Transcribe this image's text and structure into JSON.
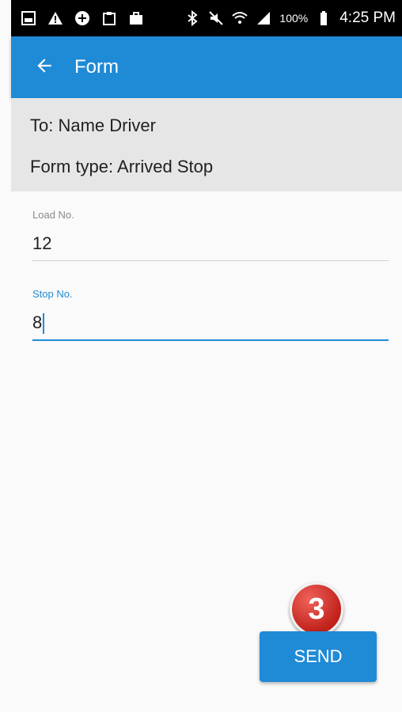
{
  "status_bar": {
    "battery": "100%",
    "time": "4:25 PM"
  },
  "app_bar": {
    "title": "Form"
  },
  "header": {
    "to_label": "To:",
    "to_value": "Name Driver",
    "form_type_label": "Form type:",
    "form_type_value": "Arrived Stop"
  },
  "form": {
    "load_no": {
      "label": "Load No.",
      "value": "12"
    },
    "stop_no": {
      "label": "Stop No.",
      "value": "8"
    }
  },
  "step_badge": "3",
  "send_button": "SEND",
  "colors": {
    "accent": "#1f8ad6",
    "header_bg": "#e6e6e6",
    "badge": "#c0211b"
  }
}
